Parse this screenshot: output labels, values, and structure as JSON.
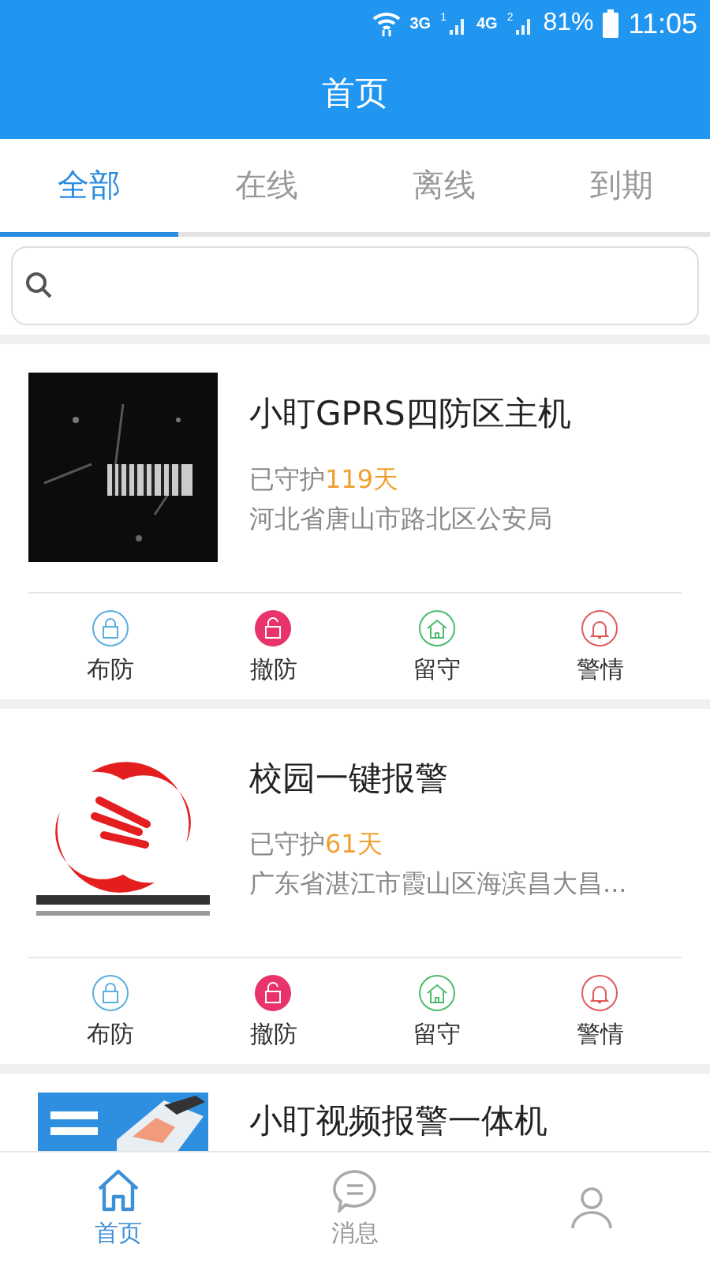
{
  "status_bar": {
    "sim_1_network": "3G",
    "sim_1_slot": "1",
    "sim_2_network": "4G",
    "sim_2_slot": "2",
    "battery": "81%",
    "time": "11:05"
  },
  "header": {
    "title": "首页"
  },
  "tabs": [
    {
      "label": "全部",
      "selected": true
    },
    {
      "label": "在线",
      "selected": false
    },
    {
      "label": "离线",
      "selected": false
    },
    {
      "label": "到期",
      "selected": false
    }
  ],
  "devices": [
    {
      "title": "小盯GPRS四防区主机",
      "guarded_label": "已守护",
      "guarded_days": "119天",
      "address": "河北省唐山市路北区公安局",
      "actions": [
        {
          "kind": "arm",
          "label": "布防",
          "color": "#5aaee0",
          "filled": false
        },
        {
          "kind": "disarm",
          "label": "撤防",
          "color": "#e8336b",
          "filled": true
        },
        {
          "kind": "stay",
          "label": "留守",
          "color": "#4cbb6c",
          "filled": false
        },
        {
          "kind": "alarm",
          "label": "警情",
          "color": "#e05a5a",
          "filled": false
        }
      ]
    },
    {
      "title": "校园一键报警",
      "guarded_label": "已守护",
      "guarded_days": "61天",
      "address": "广东省湛江市霞山区海滨昌大昌...",
      "actions": [
        {
          "kind": "arm",
          "label": "布防",
          "color": "#5aaee0",
          "filled": false
        },
        {
          "kind": "disarm",
          "label": "撤防",
          "color": "#e8336b",
          "filled": true
        },
        {
          "kind": "stay",
          "label": "留守",
          "color": "#4cbb6c",
          "filled": false
        },
        {
          "kind": "alarm",
          "label": "警情",
          "color": "#e05a5a",
          "filled": false
        }
      ]
    },
    {
      "title": "小盯视频报警一体机"
    }
  ],
  "bottom_nav": [
    {
      "kind": "home",
      "label": "首页",
      "selected": true
    },
    {
      "kind": "message",
      "label": "消息",
      "selected": false
    },
    {
      "kind": "person",
      "selected": false
    }
  ]
}
